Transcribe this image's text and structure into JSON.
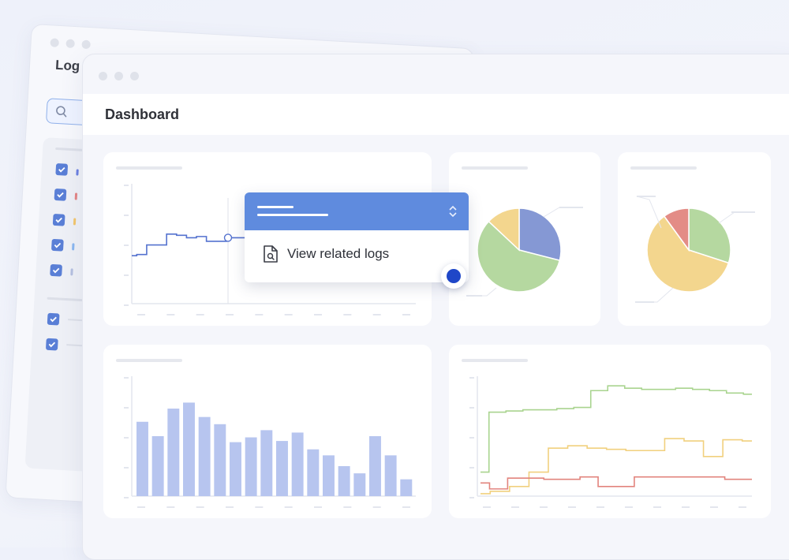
{
  "back_window": {
    "title": "Log",
    "checkbox_rows": [
      {
        "color": "#6b7fe0"
      },
      {
        "color": "#e48585"
      },
      {
        "color": "#f2c66c"
      },
      {
        "color": "#8ab6f0"
      },
      {
        "color": "#b4bfe0"
      }
    ]
  },
  "front_window": {
    "title": "Dashboard"
  },
  "popup": {
    "action_label": "View related logs",
    "icon": "file-search-icon"
  },
  "colors": {
    "accent": "#5f8bde",
    "line_blue": "#5472cf",
    "bar": "#b7c5ef",
    "pie_blue": "#8598d4",
    "pie_green": "#b5d8a0",
    "pie_yellow": "#f3d68e",
    "pie_red": "#e38c86",
    "line_green": "#a9d48f",
    "line_yellow": "#f1d07e",
    "line_red": "#e2847d",
    "cursor": "#1f47c8"
  },
  "chart_data": [
    {
      "type": "line",
      "series": [
        {
          "values": [
            40,
            41,
            49,
            49,
            58,
            57,
            55,
            56,
            52,
            52,
            55,
            55,
            51,
            51
          ]
        }
      ],
      "ylim": [
        0,
        100
      ]
    },
    {
      "type": "pie",
      "slices": [
        {
          "value": 29,
          "color": "#8598d4"
        },
        {
          "value": 58,
          "color": "#b5d8a0"
        },
        {
          "value": 13,
          "color": "#f3d68e"
        }
      ]
    },
    {
      "type": "pie",
      "slices": [
        {
          "value": 30,
          "color": "#b5d8a0"
        },
        {
          "value": 60,
          "color": "#f3d68e"
        },
        {
          "value": 10,
          "color": "#e38c86"
        }
      ]
    },
    {
      "type": "bar",
      "values": [
        62,
        50,
        73,
        78,
        66,
        60,
        45,
        49,
        55,
        46,
        53,
        39,
        34,
        25,
        19,
        50,
        34,
        14
      ],
      "ylim": [
        0,
        100
      ]
    },
    {
      "type": "line",
      "series": [
        {
          "values": [
            20,
            70,
            71,
            72,
            72,
            73,
            74,
            88,
            92,
            90,
            89,
            89,
            90,
            89,
            88,
            86,
            85
          ]
        },
        {
          "values": [
            2,
            4,
            8,
            20,
            40,
            42,
            40,
            39,
            38,
            38,
            48,
            46,
            33,
            47,
            46
          ]
        },
        {
          "values": [
            11,
            6,
            15,
            15,
            14,
            14,
            16,
            8,
            8,
            16,
            16,
            16,
            16,
            16,
            14,
            14
          ]
        }
      ],
      "ylim": [
        0,
        100
      ]
    }
  ]
}
